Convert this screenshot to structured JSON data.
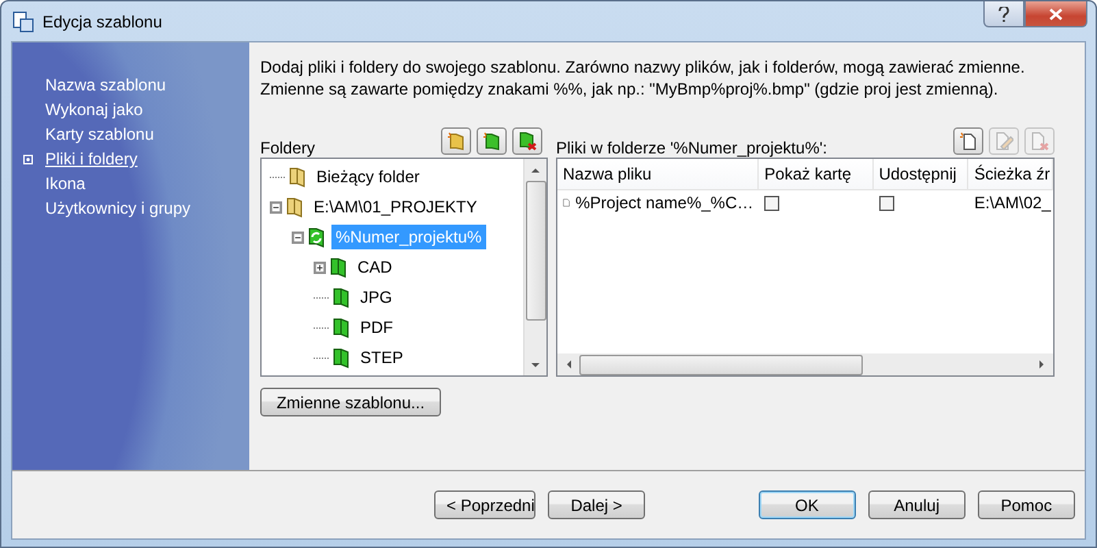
{
  "window": {
    "title": "Edycja szablonu"
  },
  "sidebar": {
    "items": [
      {
        "label": "Nazwa szablonu",
        "selected": false
      },
      {
        "label": "Wykonaj jako",
        "selected": false
      },
      {
        "label": "Karty szablonu",
        "selected": false
      },
      {
        "label": "Pliki i foldery",
        "selected": true
      },
      {
        "label": "Ikona",
        "selected": false
      },
      {
        "label": "Użytkownicy i grupy",
        "selected": false
      }
    ]
  },
  "description": "Dodaj pliki i foldery do swojego szablonu. Zarówno nazwy plików, jak i folderów, mogą zawierać zmienne. Zmienne są zawarte pomiędzy znakami %%, jak np.: \"MyBmp%proj%.bmp\" (gdzie proj jest zmienną).",
  "folders": {
    "label": "Foldery",
    "toolbar": [
      {
        "kind": "new-folder",
        "disabled": false
      },
      {
        "kind": "new-template-folder",
        "disabled": false
      },
      {
        "kind": "delete-folder",
        "disabled": false
      }
    ],
    "tree": [
      {
        "label": "Bieżący folder",
        "kind": "folder",
        "selected": false
      },
      {
        "label": "E:\\AM\\01_PROJEKTY",
        "kind": "folder",
        "selected": false,
        "expanded": true,
        "children": [
          {
            "label": "%Numer_projektu%",
            "kind": "variable-folder",
            "selected": true,
            "expanded": true,
            "children": [
              {
                "label": "CAD",
                "kind": "template-folder",
                "selected": false,
                "expanded": false
              },
              {
                "label": "JPG",
                "kind": "template-folder",
                "selected": false
              },
              {
                "label": "PDF",
                "kind": "template-folder",
                "selected": false
              },
              {
                "label": "STEP",
                "kind": "template-folder",
                "selected": false
              }
            ]
          }
        ]
      }
    ]
  },
  "files": {
    "label": "Pliki w folderze '%Numer_projektu%':",
    "toolbar": [
      {
        "kind": "new-file",
        "disabled": false
      },
      {
        "kind": "edit-file",
        "disabled": true
      },
      {
        "kind": "delete-file",
        "disabled": true
      }
    ],
    "columns": [
      "Nazwa pliku",
      "Pokaż kartę",
      "Udostępnij",
      "Ścieżka źr"
    ],
    "rows": [
      {
        "name": "%Project name%_%C…",
        "show_card": false,
        "share": false,
        "path": "E:\\AM\\02_"
      }
    ]
  },
  "variables_button": "Zmienne szablonu...",
  "buttons": [
    {
      "label": "< Poprzedni",
      "kind": "nav"
    },
    {
      "label": "Dalej >",
      "kind": "nav"
    },
    {
      "label": "OK",
      "kind": "default"
    },
    {
      "label": "Anuluj",
      "kind": "action"
    },
    {
      "label": "Pomoc",
      "kind": "action"
    }
  ]
}
